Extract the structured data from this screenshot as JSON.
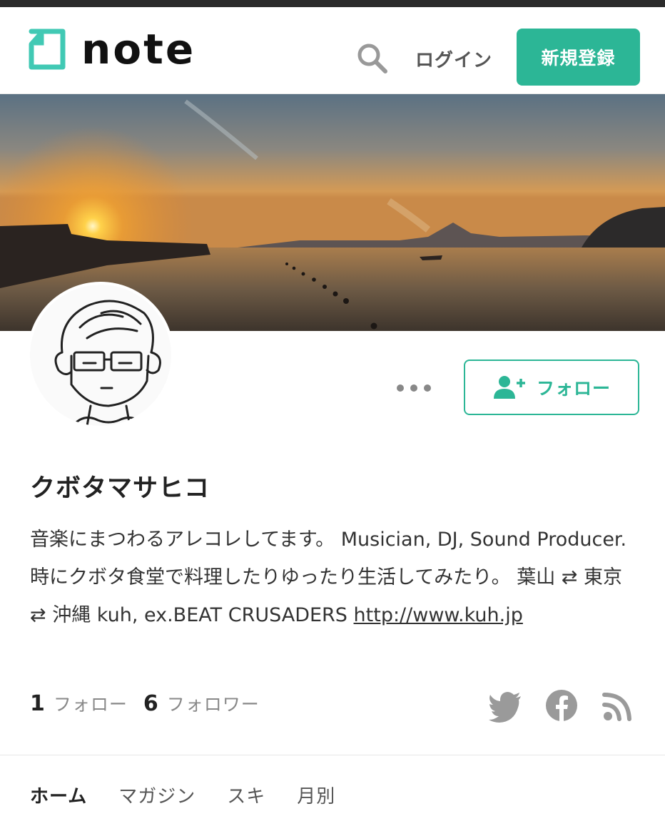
{
  "header": {
    "logo_text": "note",
    "login_label": "ログイン",
    "signup_label": "新規登録"
  },
  "profile": {
    "name": "クボタマサヒコ",
    "bio_text": "音楽にまつわるアレコレしてます。 Musician, DJ, Sound Producer. 時にクボタ食堂で料理したりゆったり生活してみたり。 葉山 ⇄ 東京 ⇄ 沖縄 kuh, ex.BEAT CRUSADERS ",
    "bio_link": "http://www.kuh.jp",
    "follow_label": "フォロー",
    "following_count": "1",
    "following_label": "フォロー",
    "followers_count": "6",
    "followers_label": "フォロワー"
  },
  "tabs": [
    "ホーム",
    "マガジン",
    "スキ",
    "月別"
  ],
  "icons": {
    "logo": "note-logo-icon",
    "search": "search-icon",
    "more": "more-dots-icon",
    "follow": "user-plus-icon",
    "twitter": "twitter-icon",
    "facebook": "facebook-icon",
    "rss": "rss-icon"
  },
  "colors": {
    "brand": "#2cb696",
    "text": "#222222",
    "muted": "#888888",
    "social_icon": "#9a9a9a"
  }
}
